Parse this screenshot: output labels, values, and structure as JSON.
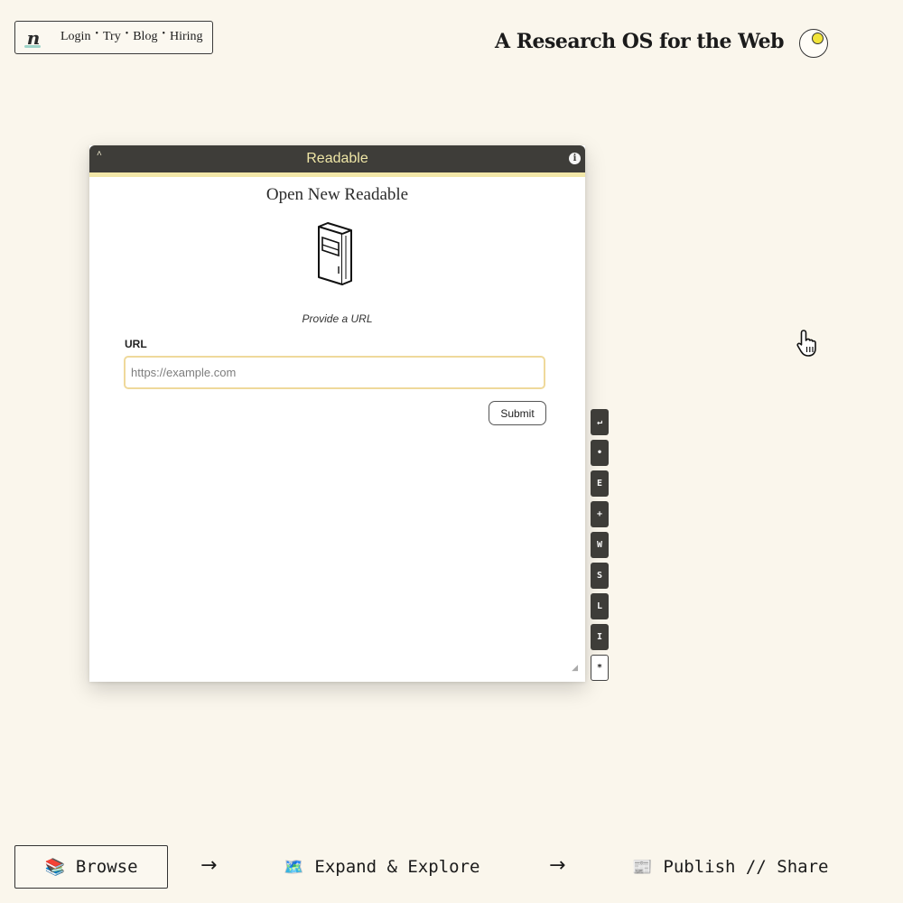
{
  "nav": {
    "logo_letter": "n",
    "links": [
      "Login",
      "Try",
      "Blog",
      "Hiring"
    ],
    "separator": "•"
  },
  "header": {
    "site_title": "A Research OS for the Web"
  },
  "window": {
    "title": "Readable",
    "collapse_glyph": "˄",
    "info_glyph": "i",
    "heading": "Open New Readable",
    "prompt": "Provide a URL",
    "url_label": "URL",
    "url_placeholder": "https://example.com",
    "url_value": "",
    "submit_label": "Submit",
    "resize_glyph": "◢"
  },
  "side_keys": [
    "↵",
    "•",
    "E",
    "+",
    "W",
    "S",
    "L",
    "I",
    "*"
  ],
  "workflow": {
    "steps": [
      {
        "emoji": "📚",
        "label": "Browse"
      },
      {
        "emoji": "🗺️",
        "label": "Expand & Explore"
      },
      {
        "emoji": "📰",
        "label": "Publish // Share"
      }
    ],
    "arrow": "→"
  },
  "colors": {
    "background": "#faf6ec",
    "titlebar": "#3e3d39",
    "title_text": "#efe6a6",
    "input_border": "#efd99b",
    "sun": "#f1e43a"
  },
  "icons": {
    "logo": "notebook-logo-icon",
    "theme": "sun-icon",
    "book": "book-icon",
    "info": "info-icon",
    "cursor": "hand-pointer-icon"
  }
}
